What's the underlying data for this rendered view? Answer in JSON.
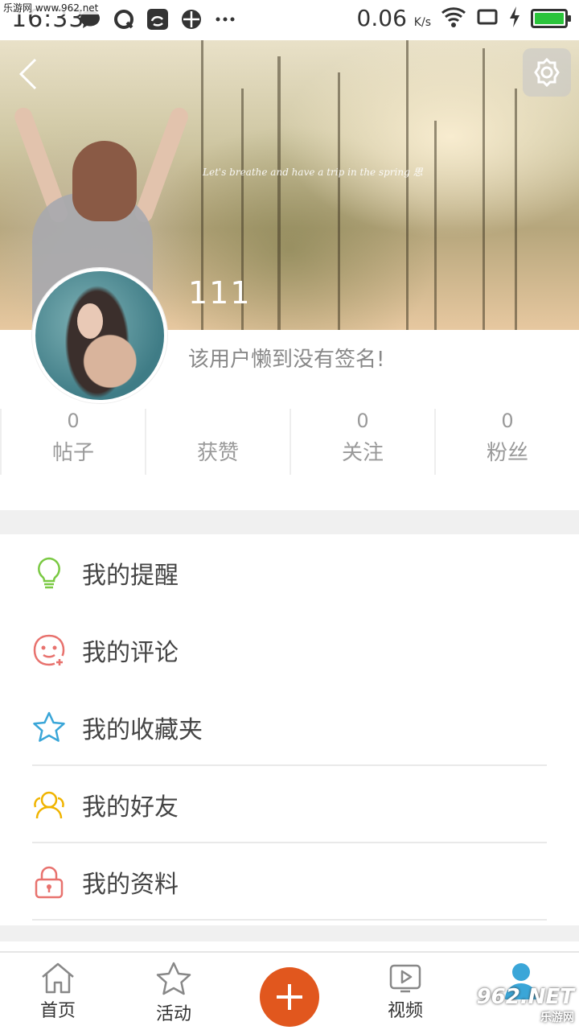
{
  "status_bar": {
    "time": "16:33",
    "speed_value": "0.06",
    "speed_unit": "K/s",
    "watermark": "乐游网 www.962.net"
  },
  "profile": {
    "username": "111",
    "signature": "该用户懒到没有签名!",
    "cover_caption": "Let's breathe and have a trip in the spring 思"
  },
  "stats": [
    {
      "value": "0",
      "label": "帖子"
    },
    {
      "value": "",
      "label": "获赞"
    },
    {
      "value": "0",
      "label": "关注"
    },
    {
      "value": "0",
      "label": "粉丝"
    }
  ],
  "menu": [
    {
      "label": "我的提醒",
      "icon": "lightbulb-icon",
      "color": "#7ac943"
    },
    {
      "label": "我的评论",
      "icon": "smiley-face-icon",
      "color": "#e8726e"
    },
    {
      "label": "我的收藏夹",
      "icon": "star-icon",
      "color": "#3aa6d8"
    },
    {
      "label": "我的好友",
      "icon": "friends-icon",
      "color": "#f0b400"
    },
    {
      "label": "我的资料",
      "icon": "lock-icon",
      "color": "#e8726e"
    }
  ],
  "bottom_nav": {
    "home": "首页",
    "activity": "活动",
    "video": "视频",
    "watermark_big": "962.NET",
    "watermark_small": "乐游网"
  },
  "colors": {
    "accent": "#e1571e",
    "profile_blue": "#3aa6d8"
  }
}
